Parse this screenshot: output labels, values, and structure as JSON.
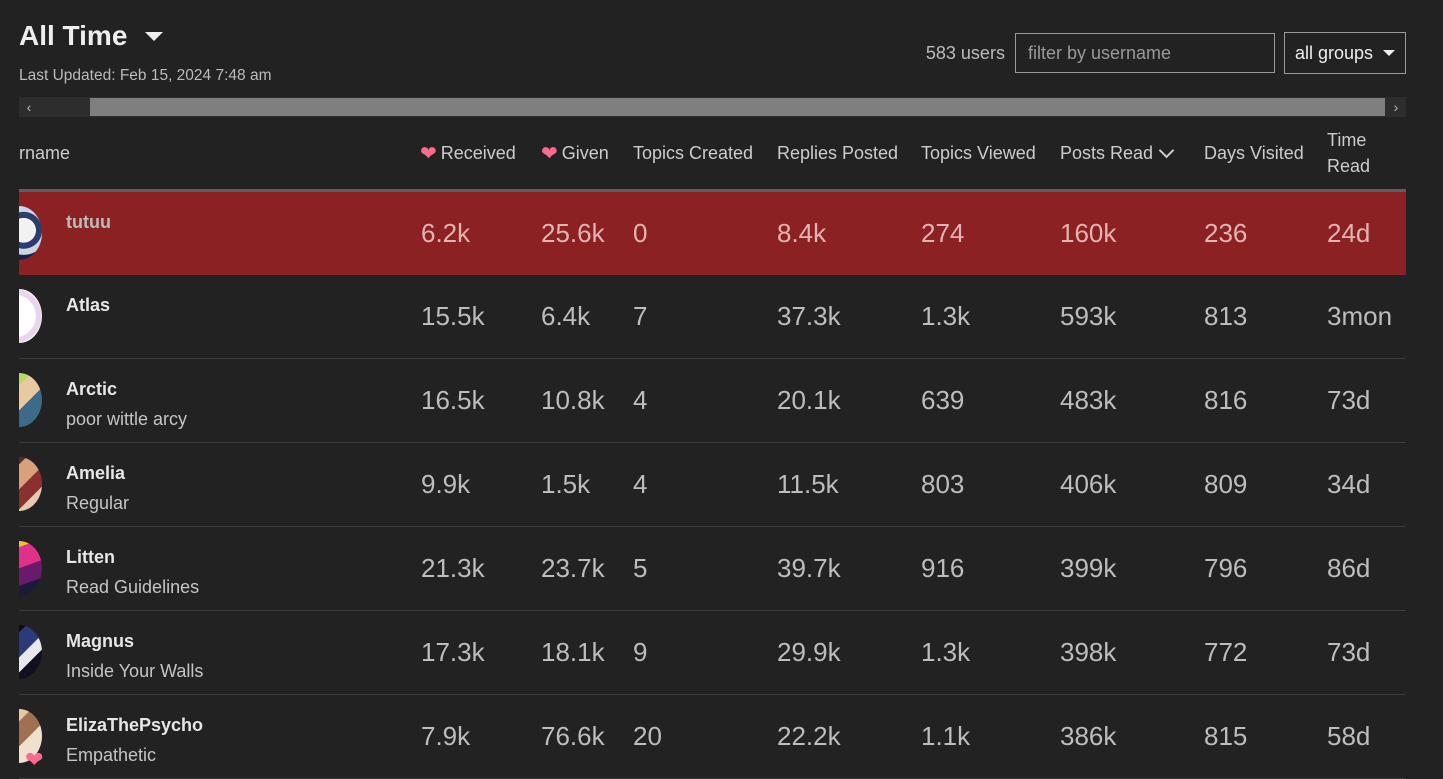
{
  "header": {
    "title": "All Time",
    "last_updated": "Last Updated: Feb 15, 2024 7:48 am",
    "user_count": "583 users",
    "filter_placeholder": "filter by username",
    "group_select": "all groups"
  },
  "columns": {
    "username": "rname",
    "received": "Received",
    "given": "Given",
    "topics_created": "Topics Created",
    "replies_posted": "Replies Posted",
    "topics_viewed": "Topics Viewed",
    "posts_read": "Posts Read",
    "days_visited": "Days Visited",
    "time_read_line1": "Time",
    "time_read_line2": "Read"
  },
  "rows": [
    {
      "username": "tutuu",
      "title": "",
      "received": "6.2k",
      "given": "25.6k",
      "topics_created": "0",
      "replies_posted": "8.4k",
      "topics_viewed": "274",
      "posts_read": "160k",
      "days_visited": "236",
      "time_read": "24d"
    },
    {
      "username": "Atlas",
      "title": "",
      "received": "15.5k",
      "given": "6.4k",
      "topics_created": "7",
      "replies_posted": "37.3k",
      "topics_viewed": "1.3k",
      "posts_read": "593k",
      "days_visited": "813",
      "time_read": "3mon"
    },
    {
      "username": "Arctic",
      "title": "poor wittle arcy",
      "received": "16.5k",
      "given": "10.8k",
      "topics_created": "4",
      "replies_posted": "20.1k",
      "topics_viewed": "639",
      "posts_read": "483k",
      "days_visited": "816",
      "time_read": "73d"
    },
    {
      "username": "Amelia",
      "title": "Regular",
      "received": "9.9k",
      "given": "1.5k",
      "topics_created": "4",
      "replies_posted": "11.5k",
      "topics_viewed": "803",
      "posts_read": "406k",
      "days_visited": "809",
      "time_read": "34d"
    },
    {
      "username": "Litten",
      "title": "Read Guidelines",
      "received": "21.3k",
      "given": "23.7k",
      "topics_created": "5",
      "replies_posted": "39.7k",
      "topics_viewed": "916",
      "posts_read": "399k",
      "days_visited": "796",
      "time_read": "86d"
    },
    {
      "username": "Magnus",
      "title": "Inside Your Walls",
      "received": "17.3k",
      "given": "18.1k",
      "topics_created": "9",
      "replies_posted": "29.9k",
      "topics_viewed": "1.3k",
      "posts_read": "398k",
      "days_visited": "772",
      "time_read": "73d"
    },
    {
      "username": "ElizaThePsycho",
      "title": "Empathetic",
      "received": "7.9k",
      "given": "76.6k",
      "topics_created": "20",
      "replies_posted": "22.2k",
      "topics_viewed": "1.1k",
      "posts_read": "386k",
      "days_visited": "815",
      "time_read": "58d"
    }
  ],
  "colors": {
    "background": "#222222",
    "highlight_row": "#8c2123",
    "heart": "#fa6c8d"
  }
}
